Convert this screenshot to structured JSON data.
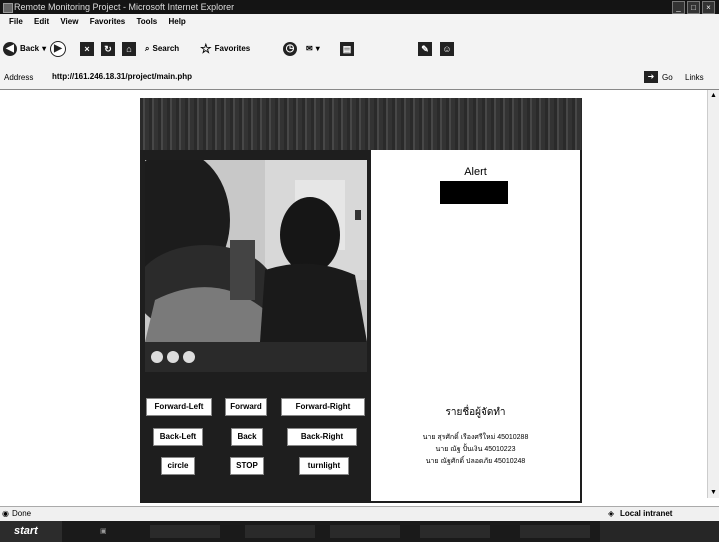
{
  "window": {
    "title": "Remote Monitoring Project - Microsoft Internet Explorer",
    "controls": [
      "_",
      "□",
      "×"
    ]
  },
  "menu": [
    "File",
    "Edit",
    "View",
    "Favorites",
    "Tools",
    "Help"
  ],
  "toolbar": {
    "back_label": "Back",
    "search_label": "Search",
    "favorites_label": "Favorites"
  },
  "address": {
    "label": "Address",
    "url": "http://161.246.18.31/project/main.php",
    "go_label": "Go",
    "links_label": "Links"
  },
  "app": {
    "alert_title": "Alert",
    "buttons_row1": [
      "Forward-Left",
      "Forward",
      "Forward-Right"
    ],
    "buttons_row2": [
      "Back-Left",
      "Back",
      "Back-Right"
    ],
    "buttons_row3": [
      "circle",
      "STOP",
      "turnlight"
    ],
    "team_title": "รายชื่อผู้จัดทำ",
    "members": [
      "นาย สุรศักดิ์ เรืองศรีใหม่ 45010288",
      "นาย ณัฐ ปั้นเงิน 45010223",
      "นาย ณัฐศักดิ์ ปลอดภัย 45010248"
    ]
  },
  "statusbar": {
    "status": "Done",
    "zone": "Local intranet"
  },
  "taskbar": {
    "start_label": "start"
  }
}
